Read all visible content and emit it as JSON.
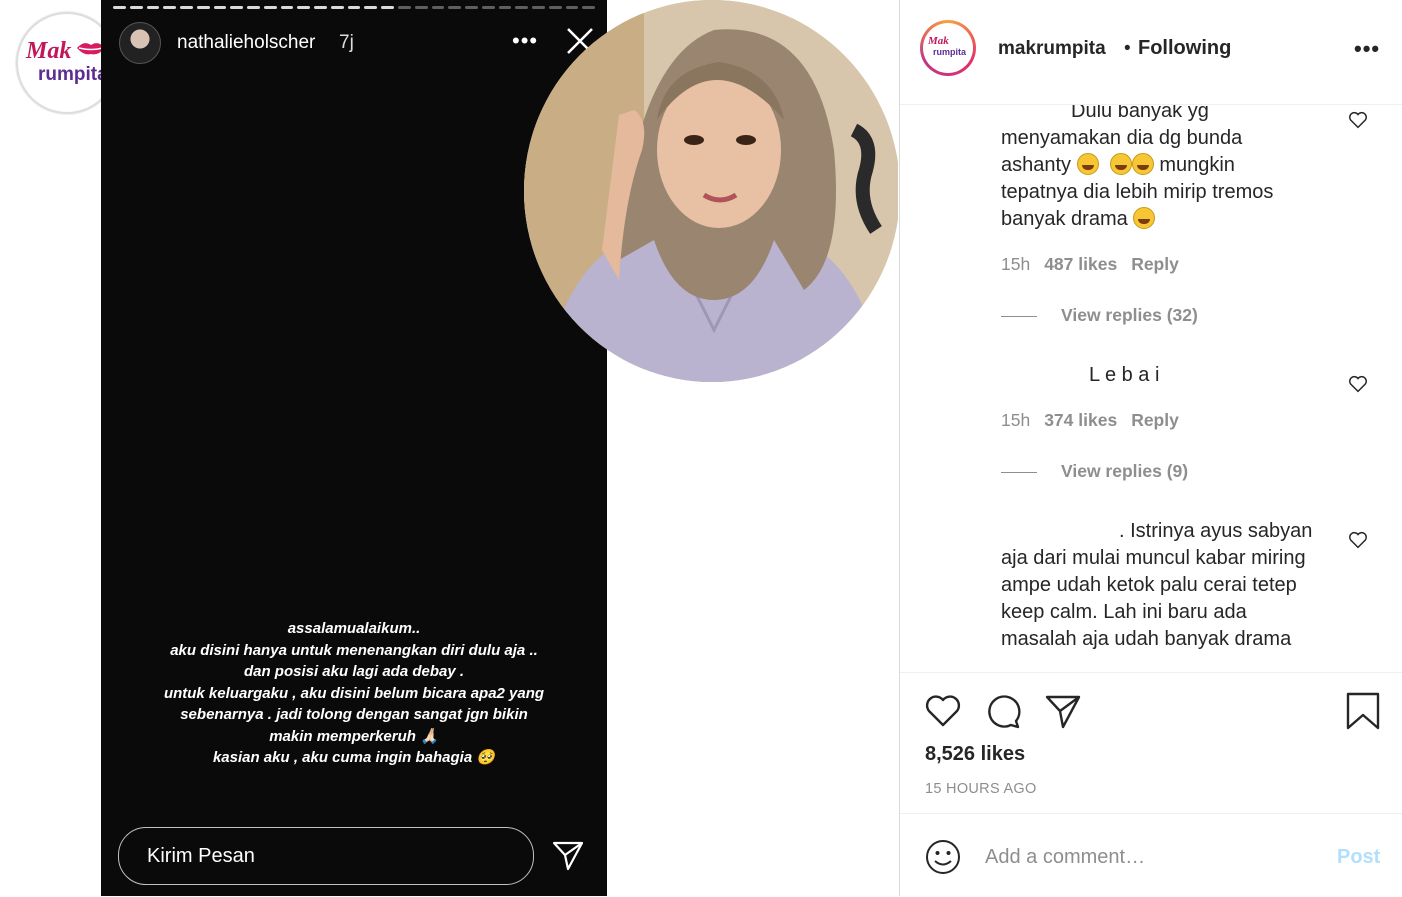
{
  "brand": {
    "logo_word1": "Mak",
    "logo_word2": "rumpita"
  },
  "story": {
    "username": "nathalieholscher",
    "time": "7j",
    "lines": [
      "assalamualaikum..",
      "aku disini hanya untuk menenangkan diri dulu aja ..",
      "dan posisi aku lagi ada debay .",
      "untuk keluargaku , aku disini belum bicara apa2 yang",
      "sebenarnya . jadi tolong dengan sangat jgn bikin",
      "makin memperkeruh 🙏🏻",
      "kasian aku , aku cuma ingin bahagia 🥺"
    ],
    "reply_placeholder": "Kirim Pesan"
  },
  "post": {
    "username": "makrumpita",
    "dot": "•",
    "follow_status": "Following",
    "comments": [
      {
        "lines": [
          "Dulu banyak yg",
          "menyamakan dia dg bunda",
          "ashanty",
          "mungkin",
          "tepatnya dia lebih mirip tremos",
          "banyak drama"
        ],
        "time": "15h",
        "likes": "487 likes",
        "reply": "Reply",
        "view_replies": "View replies (32)"
      },
      {
        "text": "L e b a i",
        "time": "15h",
        "likes": "374 likes",
        "reply": "Reply",
        "view_replies": "View replies (9)"
      },
      {
        "lines": [
          ". Istrinya ayus sabyan",
          "aja dari mulai muncul kabar miring",
          "ampe udah ketok palu cerai tetep",
          "keep calm. Lah ini baru ada",
          "masalah aja udah banyak drama"
        ]
      }
    ],
    "likes_count": "8,526 likes",
    "time_ago": "15 HOURS AGO",
    "add_comment_placeholder": "Add a comment…",
    "post_button": "Post"
  }
}
